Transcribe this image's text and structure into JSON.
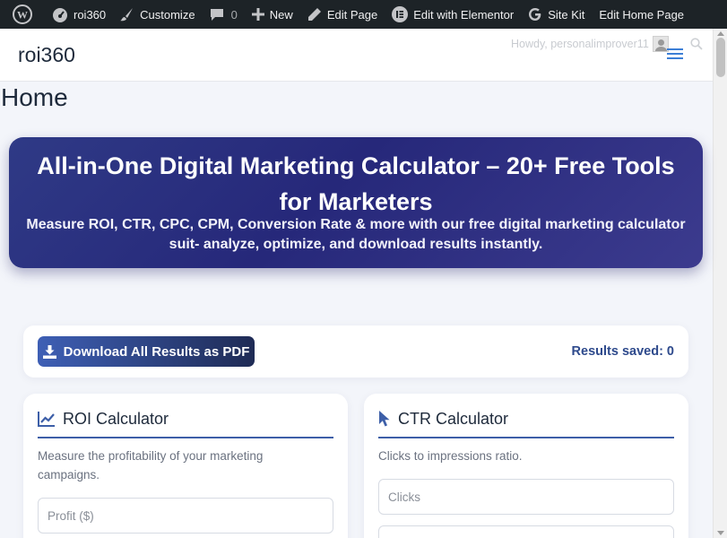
{
  "adminbar": {
    "site_name": "roi360",
    "customize": "Customize",
    "comments_count": "0",
    "new": "New",
    "edit_page": "Edit Page",
    "edit_elementor": "Edit with Elementor",
    "site_kit": "Site Kit",
    "edit_home": "Edit Home Page"
  },
  "header": {
    "site_title": "roi360",
    "howdy": "Howdy, personalimprover11"
  },
  "page": {
    "title": "Home"
  },
  "hero": {
    "title": "All-in-One Digital Marketing Calculator – 20+ Free Tools for Marketers",
    "subtitle": "Measure ROI, CTR, CPC, CPM, Conversion Rate & more with our free digital marketing calculator suit- analyze, optimize, and download results instantly."
  },
  "actions": {
    "download_label": "Download All Results as PDF",
    "results_saved": "Results saved: 0"
  },
  "cards": [
    {
      "title": "ROI Calculator",
      "icon": "chart-line-icon",
      "description": "Measure the profitability of your marketing campaigns.",
      "field_placeholder": "Profit ($)"
    },
    {
      "title": "CTR Calculator",
      "icon": "cursor-icon",
      "description": "Clicks to impressions ratio.",
      "field_placeholder": "Clicks"
    }
  ],
  "colors": {
    "accent": "#3d5fa8",
    "hero_bg": "#2b2c7e",
    "adminbar": "#1d2327"
  }
}
